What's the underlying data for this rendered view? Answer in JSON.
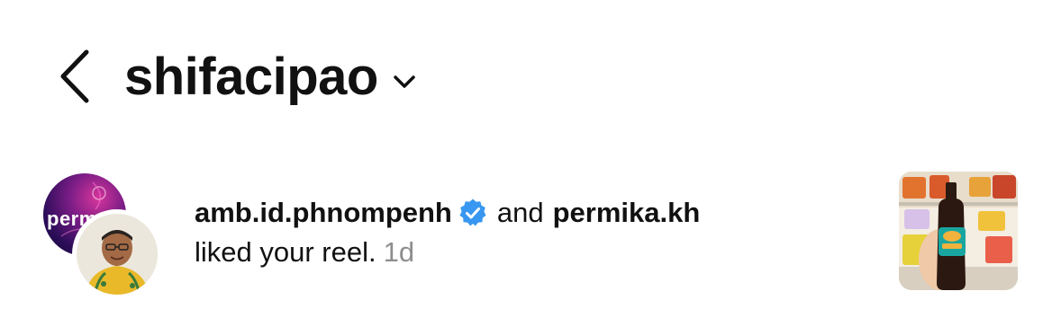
{
  "header": {
    "back_icon": "chevron-left-icon",
    "title": "shifacipao",
    "dropdown_icon": "chevron-down-icon"
  },
  "notification": {
    "avatar_back_text": "perm",
    "user1": "amb.id.phnompenh",
    "verified_icon": "verified-badge-icon",
    "connector": "and",
    "user2": "permika.kh",
    "action": "liked your reel.",
    "time": "1d",
    "thumbnail_icon": "reel-thumbnail"
  },
  "colors": {
    "text": "#111111",
    "muted": "#8e8e8e",
    "verified": "#3897f0",
    "background": "#ffffff"
  }
}
